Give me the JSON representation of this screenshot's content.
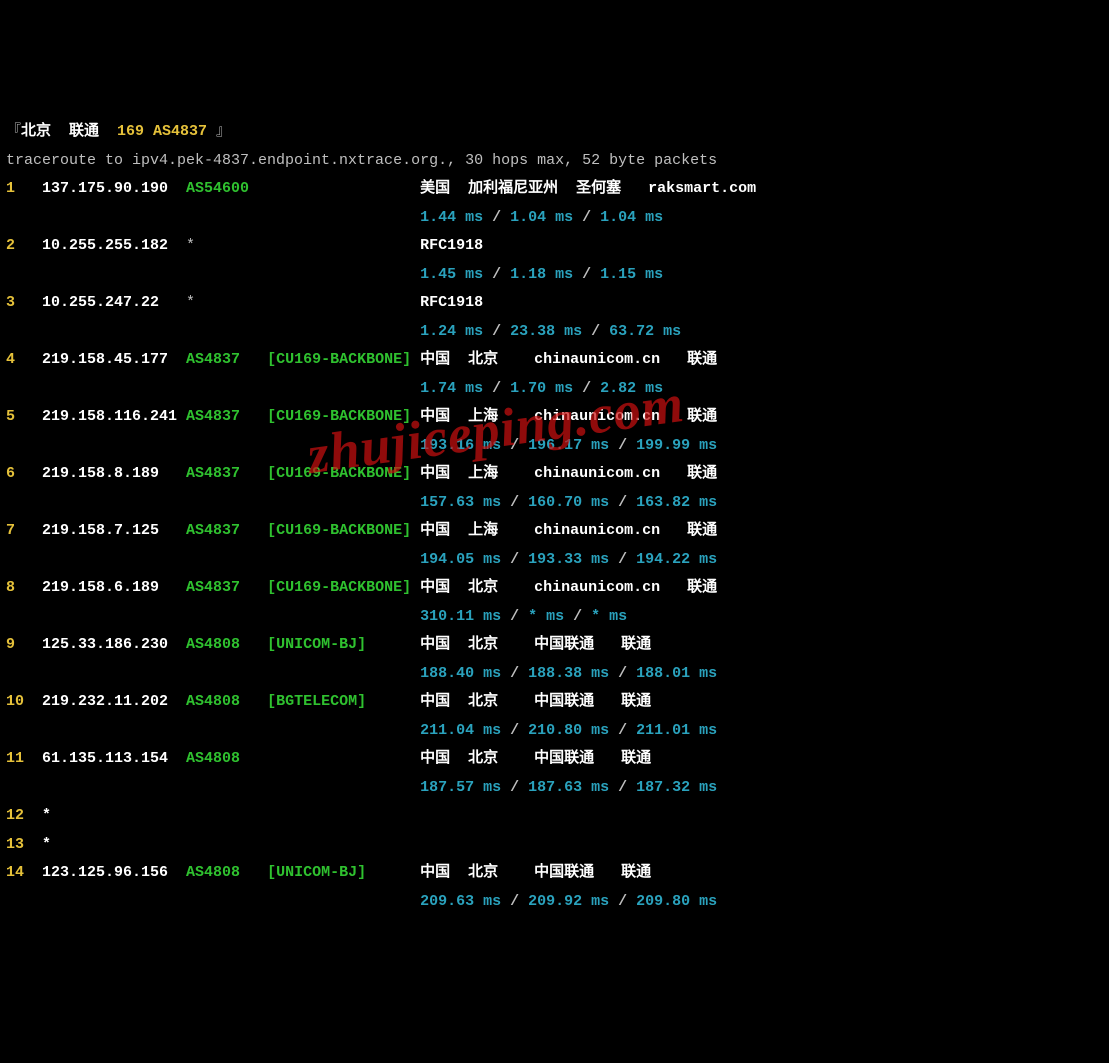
{
  "header": {
    "open_bracket": "『",
    "city": "北京",
    "isp": "联通",
    "asn_label": "169 AS4837",
    "close_bracket": "』"
  },
  "cmdline": "traceroute to ipv4.pek-4837.endpoint.nxtrace.org., 30 hops max, 52 byte packets",
  "watermark": "zhujiceping.com",
  "hops": [
    {
      "n": "1",
      "ip": "137.175.90.190",
      "asn": "AS54600",
      "tag": "",
      "loc": "美国  加利福尼亚州  圣何塞   raksmart.com",
      "rtt": [
        "1.44 ms",
        "1.04 ms",
        "1.04 ms"
      ]
    },
    {
      "n": "2",
      "ip": "10.255.255.182",
      "asn": "*",
      "tag": "",
      "loc": "RFC1918",
      "rtt": [
        "1.45 ms",
        "1.18 ms",
        "1.15 ms"
      ]
    },
    {
      "n": "3",
      "ip": "10.255.247.22",
      "asn": "*",
      "tag": "",
      "loc": "RFC1918",
      "rtt": [
        "1.24 ms",
        "23.38 ms",
        "63.72 ms"
      ]
    },
    {
      "n": "4",
      "ip": "219.158.45.177",
      "asn": "AS4837",
      "tag": "[CU169-BACKBONE]",
      "loc": "中国  北京    chinaunicom.cn   联通",
      "rtt": [
        "1.74 ms",
        "1.70 ms",
        "2.82 ms"
      ]
    },
    {
      "n": "5",
      "ip": "219.158.116.241",
      "asn": "AS4837",
      "tag": "[CU169-BACKBONE]",
      "loc": "中国  上海    chinaunicom.cn   联通",
      "rtt": [
        "193.16 ms",
        "196.17 ms",
        "199.99 ms"
      ]
    },
    {
      "n": "6",
      "ip": "219.158.8.189",
      "asn": "AS4837",
      "tag": "[CU169-BACKBONE]",
      "loc": "中国  上海    chinaunicom.cn   联通",
      "rtt": [
        "157.63 ms",
        "160.70 ms",
        "163.82 ms"
      ]
    },
    {
      "n": "7",
      "ip": "219.158.7.125",
      "asn": "AS4837",
      "tag": "[CU169-BACKBONE]",
      "loc": "中国  上海    chinaunicom.cn   联通",
      "rtt": [
        "194.05 ms",
        "193.33 ms",
        "194.22 ms"
      ]
    },
    {
      "n": "8",
      "ip": "219.158.6.189",
      "asn": "AS4837",
      "tag": "[CU169-BACKBONE]",
      "loc": "中国  北京    chinaunicom.cn   联通",
      "rtt": [
        "310.11 ms",
        "* ms",
        "* ms"
      ]
    },
    {
      "n": "9",
      "ip": "125.33.186.230",
      "asn": "AS4808",
      "tag": "[UNICOM-BJ]",
      "loc": "中国  北京    中国联通   联通",
      "rtt": [
        "188.40 ms",
        "188.38 ms",
        "188.01 ms"
      ]
    },
    {
      "n": "10",
      "ip": "219.232.11.202",
      "asn": "AS4808",
      "tag": "[BGTELECOM]",
      "loc": "中国  北京    中国联通   联通",
      "rtt": [
        "211.04 ms",
        "210.80 ms",
        "211.01 ms"
      ]
    },
    {
      "n": "11",
      "ip": "61.135.113.154",
      "asn": "AS4808",
      "tag": "",
      "loc": "中国  北京    中国联通   联通",
      "rtt": [
        "187.57 ms",
        "187.63 ms",
        "187.32 ms"
      ]
    },
    {
      "n": "12",
      "ip": "*",
      "asn": "",
      "tag": "",
      "loc": "",
      "rtt": []
    },
    {
      "n": "13",
      "ip": "*",
      "asn": "",
      "tag": "",
      "loc": "",
      "rtt": []
    },
    {
      "n": "14",
      "ip": "123.125.96.156",
      "asn": "AS4808",
      "tag": "[UNICOM-BJ]",
      "loc": "中国  北京    中国联通   联通",
      "rtt": [
        "209.63 ms",
        "209.92 ms",
        "209.80 ms"
      ]
    }
  ]
}
